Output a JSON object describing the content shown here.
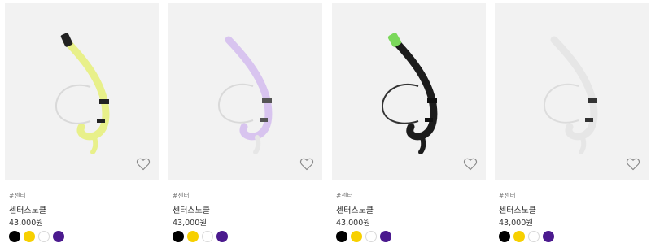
{
  "products": [
    {
      "tag": "#센터",
      "name": "센터스노클",
      "price": "43,000원",
      "tube_color": "#e8f08a",
      "tip_color": "#222222"
    },
    {
      "tag": "#센터",
      "name": "센터스노클",
      "price": "43,000원",
      "tube_color": "#d8c4ef",
      "tip_color": "#d8c4ef"
    },
    {
      "tag": "#센터",
      "name": "센터스노클",
      "price": "43,000원",
      "tube_color": "#1c1c1c",
      "tip_color": "#7ad85a"
    },
    {
      "tag": "#센터",
      "name": "센터스노클",
      "price": "43,000원",
      "tube_color": "#ececec",
      "tip_color": "#ececec"
    }
  ],
  "swatch_colors": [
    "#000000",
    "#f7d000",
    "#ffffff",
    "#4b1a8e"
  ],
  "icons": {
    "wishlist": "heart-outline-icon"
  }
}
